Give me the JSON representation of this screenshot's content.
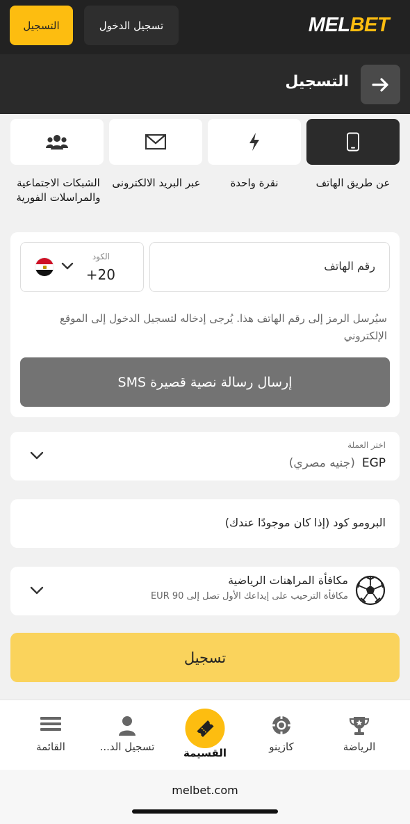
{
  "topbar": {
    "register_label": "التسجيل",
    "login_label": "تسجيل الدخول",
    "logo_mel": "MEL",
    "logo_bet": "BET"
  },
  "header": {
    "title": "التسجيل",
    "back_icon": "arrow-right-icon"
  },
  "methods": [
    {
      "label": "عن طريق الهاتف",
      "icon": "phone-icon",
      "active": true
    },
    {
      "label": "نقرة واحدة",
      "icon": "lightning-icon",
      "active": false
    },
    {
      "label": "عبر البريد الالكترونى",
      "icon": "envelope-icon",
      "active": false
    },
    {
      "label": "الشبكات الاجتماعية والمراسلات الفورية",
      "icon": "users-icon",
      "active": false
    }
  ],
  "phone_form": {
    "code_label": "الكود",
    "code_value": "+20",
    "country_flag": "egypt-flag",
    "phone_placeholder": "رقم الهاتف",
    "notice": "سيُرسل الرمز إلى رقم الهاتف هذا. يُرجى إدخاله لتسجيل الدخول إلى الموقع الإلكتروني",
    "sms_button": "إرسال رسالة نصية قصيرة SMS"
  },
  "currency": {
    "label": "اختر العملة",
    "code": "EGP",
    "name": "(جنيه مصري)"
  },
  "promo": {
    "placeholder": "البرومو كود (إذا كان موجودًا عندك)"
  },
  "bonus": {
    "title": "مكافأة المراهنات الرياضية",
    "subtitle": "مكافأة الترحيب على إيداعك الأول تصل إلى 90 EUR",
    "icon": "soccer-ball-icon"
  },
  "submit_label": "تسجيل",
  "bottom_nav": {
    "sports": "الرياضة",
    "casino": "كازينو",
    "coupon": "القسيمة",
    "login": "تسجيل الد...",
    "menu": "القائمة"
  },
  "browser": {
    "url": "melbet.com"
  },
  "colors": {
    "brand_yellow": "#fdbd10",
    "dark": "#222222"
  }
}
